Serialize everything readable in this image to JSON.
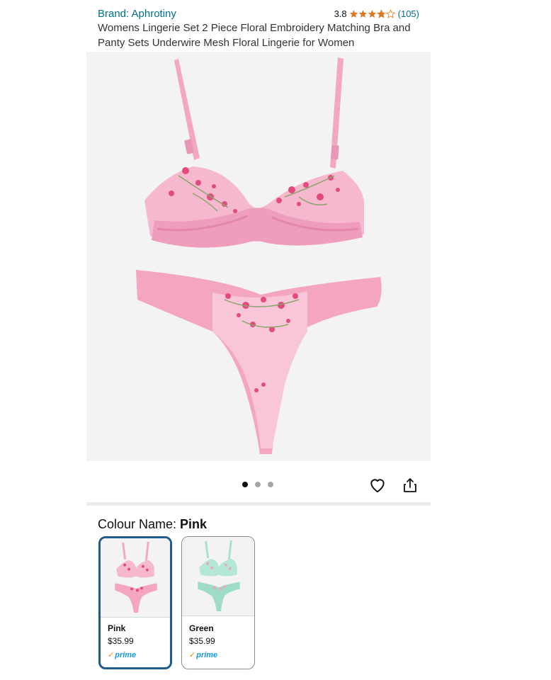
{
  "product": {
    "brand": "Brand: Aphrotiny",
    "rating_value": "3.8",
    "rating_stars": 3.8,
    "review_count": "(105)",
    "title": "Womens Lingerie Set 2 Piece Floral Embroidery Matching Bra and Panty Sets Underwire Mesh Floral Lingerie for Women"
  },
  "gallery": {
    "image_subject": "pink-floral-embroidered-bra-and-panty",
    "total_images": 3,
    "active_index": 0
  },
  "actions": {
    "wishlist_icon": "heart-icon",
    "share_icon": "share-icon"
  },
  "colour": {
    "label": "Colour Name: ",
    "selected": "Pink",
    "options": [
      {
        "name": "Pink",
        "price": "$35.99",
        "prime": "prime",
        "color": "#f4a5c2",
        "selected": true
      },
      {
        "name": "Green",
        "price": "$35.99",
        "prime": "prime",
        "color": "#9fdcc8",
        "selected": false
      }
    ]
  },
  "colors": {
    "link": "#007185",
    "star": "#de7921",
    "selected_border": "#1f5b8b",
    "prime": "#1399d6",
    "prime_check": "#f08804"
  }
}
